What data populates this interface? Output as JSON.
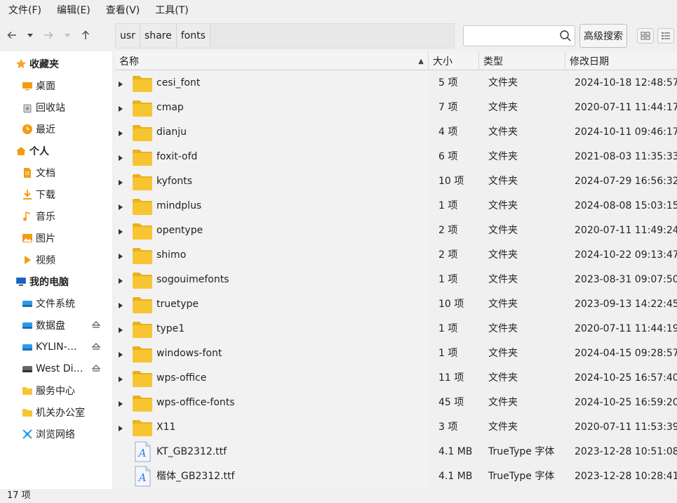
{
  "menubar": {
    "items": [
      "文件(F)",
      "编辑(E)",
      "查看(V)",
      "工具(T)"
    ]
  },
  "toolbar": {
    "breadcrumb": [
      "usr",
      "share",
      "fonts"
    ],
    "search": {
      "value": "",
      "placeholder": ""
    },
    "advanced_search_label": "高级搜索"
  },
  "sidebar": {
    "items": [
      {
        "label": "收藏夹",
        "icon": "star-icon",
        "head": true
      },
      {
        "label": "桌面",
        "icon": "desktop-icon",
        "head": false
      },
      {
        "label": "回收站",
        "icon": "trash-icon",
        "head": false
      },
      {
        "label": "最近",
        "icon": "clock-icon",
        "head": false
      },
      {
        "label": "个人",
        "icon": "home-icon",
        "head": true
      },
      {
        "label": "文档",
        "icon": "document-icon",
        "head": false
      },
      {
        "label": "下载",
        "icon": "download-icon",
        "head": false
      },
      {
        "label": "音乐",
        "icon": "music-icon",
        "head": false
      },
      {
        "label": "图片",
        "icon": "picture-icon",
        "head": false
      },
      {
        "label": "视频",
        "icon": "video-icon",
        "head": false
      },
      {
        "label": "我的电脑",
        "icon": "computer-icon",
        "head": true
      },
      {
        "label": "文件系统",
        "icon": "drive-icon",
        "head": false
      },
      {
        "label": "数据盘",
        "icon": "drive-icon",
        "head": false,
        "eject": true
      },
      {
        "label": "KYLIN-…",
        "icon": "drive-icon",
        "head": false,
        "eject": true
      },
      {
        "label": "West Di…",
        "icon": "usb-drive-icon",
        "head": false,
        "eject": true
      },
      {
        "label": "服务中心",
        "icon": "folder-icon",
        "head": false
      },
      {
        "label": "机关办公室",
        "icon": "folder-icon",
        "head": false
      },
      {
        "label": "浏览网络",
        "icon": "network-icon",
        "head": false
      }
    ]
  },
  "columns": {
    "name": "名称",
    "size": "大小",
    "type": "类型",
    "date": "修改日期"
  },
  "files": [
    {
      "name": "cesi_font",
      "size": "5 项",
      "type": "文件夹",
      "date": "2024-10-18 12:48:57",
      "kind": "folder"
    },
    {
      "name": "cmap",
      "size": "7 项",
      "type": "文件夹",
      "date": "2020-07-11 11:44:17",
      "kind": "folder"
    },
    {
      "name": "dianju",
      "size": "4 项",
      "type": "文件夹",
      "date": "2024-10-11 09:46:17",
      "kind": "folder"
    },
    {
      "name": "foxit-ofd",
      "size": "6 项",
      "type": "文件夹",
      "date": "2021-08-03 11:35:33",
      "kind": "folder"
    },
    {
      "name": "kyfonts",
      "size": "10 项",
      "type": "文件夹",
      "date": "2024-07-29 16:56:32",
      "kind": "folder"
    },
    {
      "name": "mindplus",
      "size": "1 项",
      "type": "文件夹",
      "date": "2024-08-08 15:03:15",
      "kind": "folder"
    },
    {
      "name": "opentype",
      "size": "2 项",
      "type": "文件夹",
      "date": "2020-07-11 11:49:24",
      "kind": "folder"
    },
    {
      "name": "shimo",
      "size": "2 项",
      "type": "文件夹",
      "date": "2024-10-22 09:13:47",
      "kind": "folder"
    },
    {
      "name": "sogouimefonts",
      "size": "1 项",
      "type": "文件夹",
      "date": "2023-08-31 09:07:50",
      "kind": "folder"
    },
    {
      "name": "truetype",
      "size": "10 项",
      "type": "文件夹",
      "date": "2023-09-13 14:22:45",
      "kind": "folder"
    },
    {
      "name": "type1",
      "size": "1 项",
      "type": "文件夹",
      "date": "2020-07-11 11:44:19",
      "kind": "folder"
    },
    {
      "name": "windows-font",
      "size": "1 项",
      "type": "文件夹",
      "date": "2024-04-15 09:28:57",
      "kind": "folder"
    },
    {
      "name": "wps-office",
      "size": "11 项",
      "type": "文件夹",
      "date": "2024-10-25 16:57:40",
      "kind": "folder"
    },
    {
      "name": "wps-office-fonts",
      "size": "45 项",
      "type": "文件夹",
      "date": "2024-10-25 16:59:20",
      "kind": "folder"
    },
    {
      "name": "X11",
      "size": "3 项",
      "type": "文件夹",
      "date": "2020-07-11 11:53:39",
      "kind": "folder"
    },
    {
      "name": "KT_GB2312.ttf",
      "size": "4.1 MB",
      "type": "TrueType 字体",
      "date": "2023-12-28 10:51:08",
      "kind": "font"
    },
    {
      "name": "楷体_GB2312.ttf",
      "size": "4.1 MB",
      "type": "TrueType 字体",
      "date": "2023-12-28 10:28:41",
      "kind": "font"
    }
  ],
  "status": {
    "text": "17 项"
  },
  "colors": {
    "folder": "#f7c531",
    "folder_dark": "#e8b11d",
    "accent": "#2b7de9"
  }
}
